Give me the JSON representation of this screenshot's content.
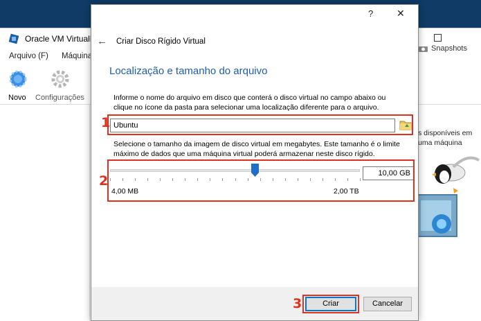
{
  "background_app": {
    "title": "Oracle VM VirtualB",
    "menu": [
      "Arquivo (F)",
      "Máquina"
    ],
    "tools": [
      {
        "label": "Novo",
        "icon": "new-vm-icon"
      },
      {
        "label": "Configurações",
        "icon": "settings-gear-icon"
      }
    ],
    "snapshots_label": "Snapshots",
    "right_text_1": "s disponíveis em",
    "right_text_2": "uma máquina"
  },
  "dialog": {
    "help": "?",
    "close": "✕",
    "back": "←",
    "title": "Criar Disco Rígido Virtual",
    "heading": "Localização e tamanho do arquivo",
    "location_desc": "Informe o nome do arquivo em disco que conterá o disco virtual no campo abaixo ou clique no ícone da pasta para selecionar uma localização diferente para o arquivo.",
    "file_name": "Ubuntu",
    "size_desc": "Selecione o tamanho da imagem de disco virtual em megabytes. Este tamanho é o limite máximo de dados que uma máquina virtual poderá armazenar neste disco rígido.",
    "size_value": "10,00 GB",
    "range_min": "4,00 MB",
    "range_max": "2,00 TB",
    "slider_fraction": 0.58,
    "create_button": "Criar",
    "cancel_button": "Cancelar"
  },
  "annotations": [
    "1",
    "2",
    "3"
  ],
  "colors": {
    "accent": "#1f5ea8",
    "annotation": "#e0301e",
    "slider_thumb": "#1e6fc5"
  }
}
